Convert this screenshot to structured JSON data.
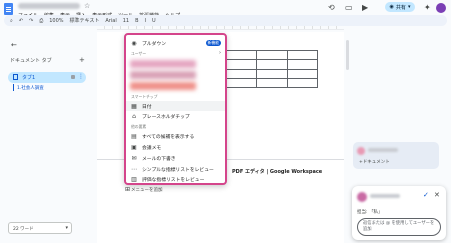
{
  "menubar": {
    "items": [
      "ファイル",
      "編集",
      "表示",
      "挿入",
      "表示形式",
      "ツール",
      "拡張機能",
      "ヘルプ"
    ]
  },
  "header": {
    "share_label": "共有"
  },
  "toolbar": {
    "items": [
      "100%",
      "標準テキスト",
      "Arial",
      "11",
      "B",
      "I",
      "U"
    ]
  },
  "sidebar": {
    "title": "ドキュメント タブ",
    "tab_label": "タブ1",
    "heading": "1.社会人調査",
    "word_count": "22 ワード"
  },
  "menu": {
    "items": [
      {
        "icon": "chip-icon",
        "label": "プルダウン",
        "badge": "新機能"
      },
      {
        "section": "ユーザー"
      },
      {
        "section": "スマートチップ"
      },
      {
        "icon": "calendar-icon",
        "label": "日付"
      },
      {
        "icon": "place-icon",
        "label": "プレースホルダチップ"
      },
      {
        "section": "他の要素"
      },
      {
        "icon": "doc-icon",
        "label": "すべての候補を表示する"
      },
      {
        "icon": "note-icon",
        "label": "会議メモ"
      },
      {
        "icon": "mail-icon",
        "label": "メールの下書き"
      },
      {
        "icon": "dots-icon",
        "label": "シンプルな指標リストをレビュー"
      },
      {
        "icon": "review-icon",
        "label": "評価な指標リストをレビュー"
      }
    ]
  },
  "document": {
    "line_text": "PDF エディタ | Google Workspace",
    "add_comment": "メニューを追加"
  },
  "comments": {
    "card1_text": "+ドキュメント",
    "assign_label": "担当: 「私」",
    "input_placeholder": "返信または @ を使用してユーザーを追加"
  }
}
